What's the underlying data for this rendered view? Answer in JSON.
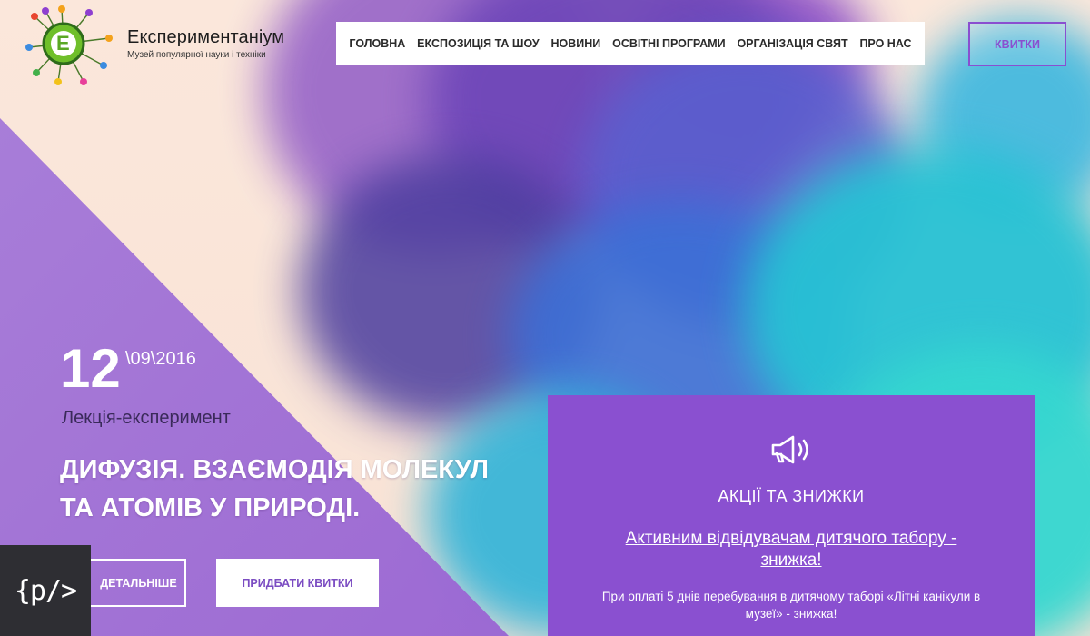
{
  "brand": {
    "logo_letter": "E",
    "name": "Експериментаніум",
    "tagline": "Музей популярної науки і техніки"
  },
  "nav": {
    "items": [
      {
        "label": "ГОЛОВНА"
      },
      {
        "label": "ЕКСПОЗИЦІЯ ТА ШОУ"
      },
      {
        "label": "НОВИНИ"
      },
      {
        "label": "ОСВІТНІ ПРОГРАМИ"
      },
      {
        "label": "ОРГАНІЗАЦІЯ СВЯТ"
      },
      {
        "label": "ПРО НАС"
      }
    ],
    "tickets_label": "КВИТКИ"
  },
  "event": {
    "day": "12",
    "month_year": "\\09\\2016",
    "type": "Лекція-експеримент",
    "title_line1": "ДИФУЗІЯ. ВЗАЄМОДІЯ МОЛЕКУЛ",
    "title_line2": "ТА АТОМІВ У ПРИРОДІ.",
    "details_label": "ДЕТАЛЬНІШЕ",
    "buy_label": "ПРИДБАТИ КВИТКИ"
  },
  "code_badge": {
    "label": "{p/>"
  },
  "promo": {
    "icon": "megaphone-icon",
    "heading": "АКЦІЇ ТА ЗНИЖКИ",
    "link_text": "Активним відвідувачам дитячого табору - знижка!",
    "text": "При оплаті 5 днів перебування в дитячому таборі «Літні канікули в музеї» - знижка!"
  },
  "colors": {
    "accent": "#8a50d0",
    "background": "#fbe9dd",
    "violet_panel": "#a777dc",
    "dark_badge": "#2e2e33"
  }
}
